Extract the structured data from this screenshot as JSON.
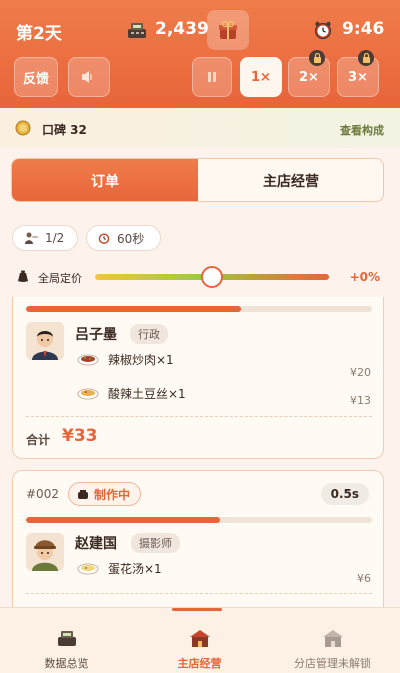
{
  "header": {
    "day": "第2天",
    "money": "2,439",
    "time": "9:46",
    "money_icon": "cash-register-icon",
    "shop_icon": "gift-box-icon",
    "clock_icon": "alarm-clock-icon"
  },
  "controls": {
    "feedback_label": "反馈",
    "sound_icon": "speaker-mute-icon",
    "pause_icon": "pause-icon",
    "speed_1x": "1×",
    "speed_2x": "2×",
    "speed_3x": "3×",
    "lock_icon": "lock-icon"
  },
  "reputation": {
    "label": "口碑 32",
    "link": "查看构成"
  },
  "tabs": {
    "orders": "订单",
    "main_store": "主店经营"
  },
  "status_chips": {
    "staff": "1/2",
    "timer": "60秒"
  },
  "pricing": {
    "label": "全局定价",
    "percent": "+0%",
    "level": 0.5
  },
  "orders": [
    {
      "customer": "吕子墨",
      "tag": "行政",
      "progress": 0.62,
      "items": [
        {
          "name": "辣椒炒肉×1",
          "price": "¥20"
        },
        {
          "name": "酸辣土豆丝×1",
          "price": "¥13"
        }
      ],
      "total_label": "合计",
      "total": "¥33"
    },
    {
      "number": "#002",
      "status": "制作中",
      "timer": "0.5s",
      "customer": "赵建国",
      "tag": "摄影师",
      "progress": 0.56,
      "items": [
        {
          "name": "蛋花汤×1",
          "price": "¥6"
        }
      ]
    }
  ],
  "bottom_nav": {
    "data": "数据总览",
    "main": "主店经营",
    "branch": "分店管理未解锁"
  },
  "colors": {
    "accent": "#e8643a",
    "background": "#fdf3ec"
  }
}
